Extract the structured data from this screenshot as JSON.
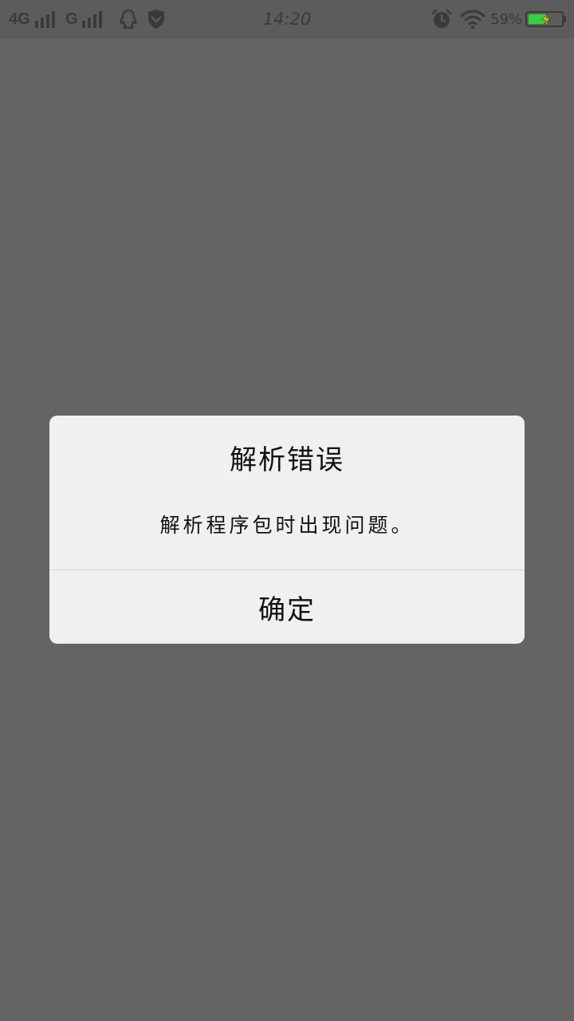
{
  "status_bar": {
    "network_primary": "4G",
    "network_secondary": "G",
    "time": "14:20",
    "battery_percent": "59%",
    "battery_level": 0.59,
    "icons": [
      "signal-icon",
      "qq-icon",
      "shield-icon",
      "alarm-icon",
      "wifi-icon",
      "battery-charging-icon"
    ]
  },
  "dialog": {
    "title": "解析错误",
    "message": "解析程序包时出现问题。",
    "ok_label": "确定"
  },
  "colors": {
    "overlay": "#646464",
    "status_bar": "#5c5c5c",
    "dialog_bg": "#f0f0f0",
    "battery_fill": "#34d13f",
    "divider": "#d4d4d4"
  }
}
